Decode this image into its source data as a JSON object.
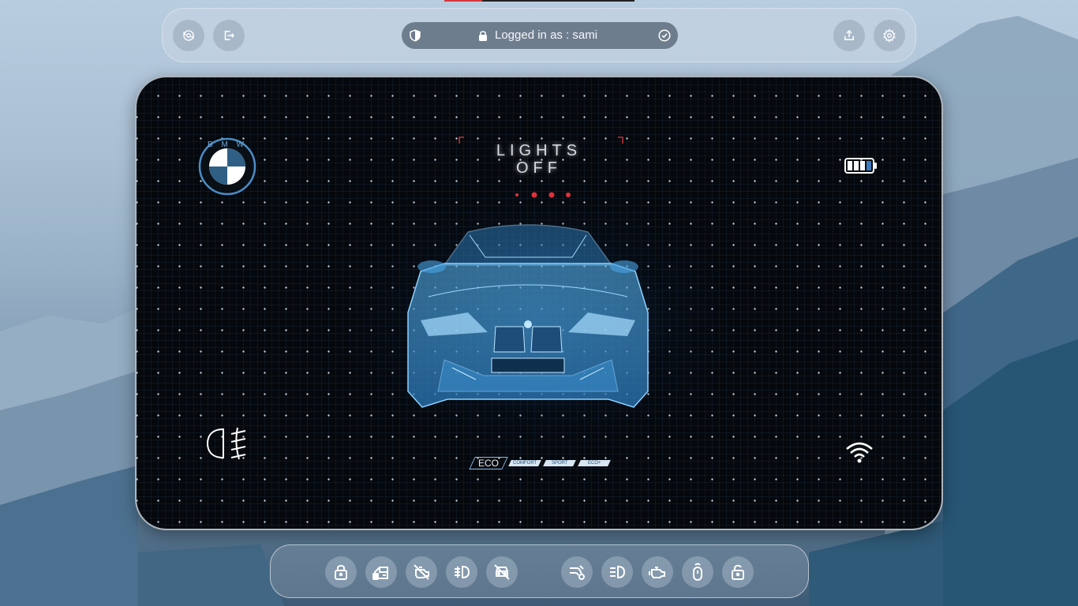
{
  "header": {
    "user_prefix": "Logged in as : ",
    "username": "sami",
    "login_text": "Logged in as : sami"
  },
  "dashboard": {
    "brand_logo_text": "B M W",
    "lights_status_line1": "LIGHTS",
    "lights_status_line2": "OFF",
    "battery_level": 0.75,
    "drive_modes": [
      {
        "label": "ECO",
        "active": true
      },
      {
        "label": "COMFORT",
        "active": false
      },
      {
        "label": "SPORT",
        "active": false
      },
      {
        "label": "ECO+",
        "active": false
      }
    ]
  },
  "bottom_controls": [
    {
      "icon": "lock-icon"
    },
    {
      "icon": "car-door-icon"
    },
    {
      "icon": "engine-off-icon"
    },
    {
      "icon": "fog-light-icon"
    },
    {
      "icon": "car-off-icon"
    },
    {
      "icon": "exhaust-icon"
    },
    {
      "icon": "low-beam-icon"
    },
    {
      "icon": "engine-icon"
    },
    {
      "icon": "key-fob-icon"
    },
    {
      "icon": "unlock-icon"
    }
  ],
  "colors": {
    "accent_blue": "#4da7e8",
    "alert_red": "#e0303a",
    "panel_bg": "#05080c"
  }
}
